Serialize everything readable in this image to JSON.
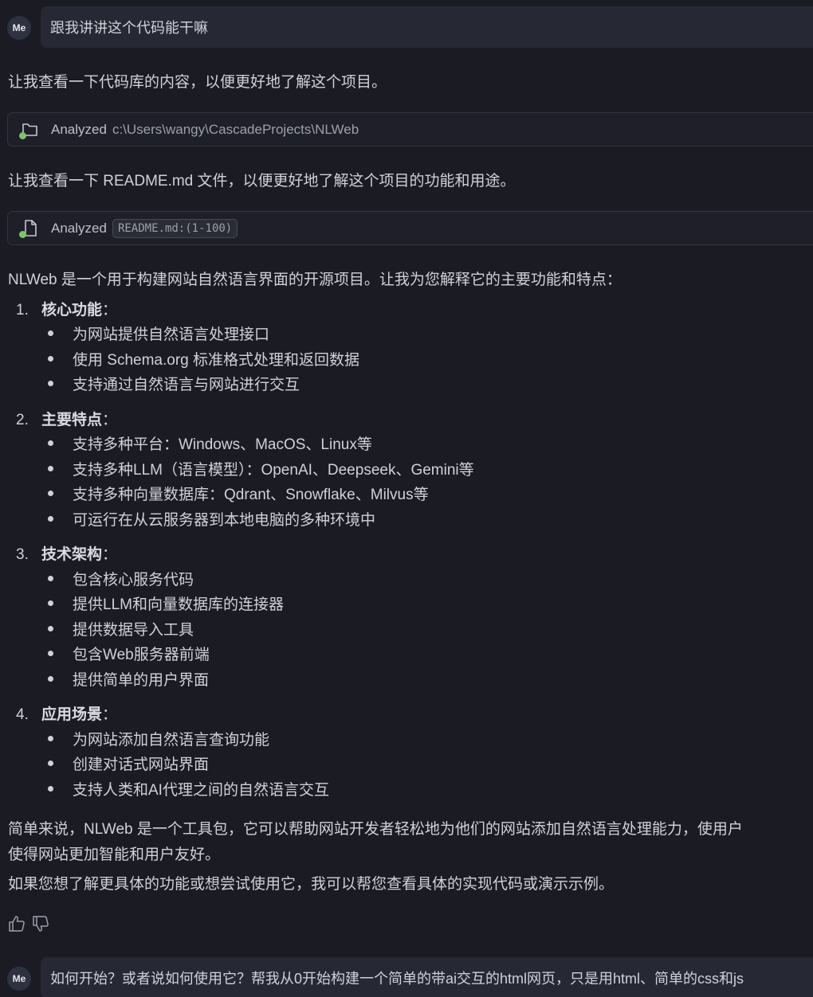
{
  "messages": {
    "user1": {
      "avatar": "Me",
      "text": "跟我讲讲这个代码能干嘛"
    },
    "assistant": {
      "p1": "让我查看一下代码库的内容，以便更好地了解这个项目。",
      "tool1": {
        "label": "Analyzed",
        "path": "c:\\Users\\wangy\\CascadeProjects\\NLWeb",
        "icon": "folder-icon"
      },
      "p2": "让我查看一下 README.md 文件，以便更好地了解这个项目的功能和用途。",
      "tool2": {
        "label": "Analyzed",
        "code": "README.md:(1-100)",
        "icon": "file-icon"
      },
      "intro": "NLWeb 是一个用于构建网站自然语言界面的开源项目。让我为您解释它的主要功能和特点：",
      "sections": [
        {
          "num": "1.",
          "title": "核心功能",
          "colon": "：",
          "items": [
            "为网站提供自然语言处理接口",
            "使用 Schema.org 标准格式处理和返回数据",
            "支持通过自然语言与网站进行交互"
          ]
        },
        {
          "num": "2.",
          "title": "主要特点",
          "colon": "：",
          "items": [
            "支持多种平台：Windows、MacOS、Linux等",
            "支持多种LLM（语言模型）：OpenAI、Deepseek、Gemini等",
            "支持多种向量数据库：Qdrant、Snowflake、Milvus等",
            "可运行在从云服务器到本地电脑的多种环境中"
          ]
        },
        {
          "num": "3.",
          "title": "技术架构",
          "colon": "：",
          "items": [
            "包含核心服务代码",
            "提供LLM和向量数据库的连接器",
            "提供数据导入工具",
            "包含Web服务器前端",
            "提供简单的用户界面"
          ]
        },
        {
          "num": "4.",
          "title": "应用场景",
          "colon": "：",
          "items": [
            "为网站添加自然语言查询功能",
            "创建对话式网站界面",
            "支持人类和AI代理之间的自然语言交互"
          ]
        }
      ],
      "summary1": "简单来说，NLWeb 是一个工具包，它可以帮助网站开发者轻松地为他们的网站添加自然语言处理能力，使用户",
      "summary2": "使得网站更加智能和用户友好。",
      "closing": "如果您想了解更具体的功能或想尝试使用它，我可以帮您查看具体的实现代码或演示示例。",
      "feedback": {
        "up_icon": "thumbs-up-icon",
        "down_icon": "thumbs-down-icon"
      }
    },
    "user2": {
      "avatar": "Me",
      "text": "如何开始？或者说如何使用它？帮我从0开始构建一个简单的带ai交互的html网页，只是用html、简单的css和js"
    }
  }
}
